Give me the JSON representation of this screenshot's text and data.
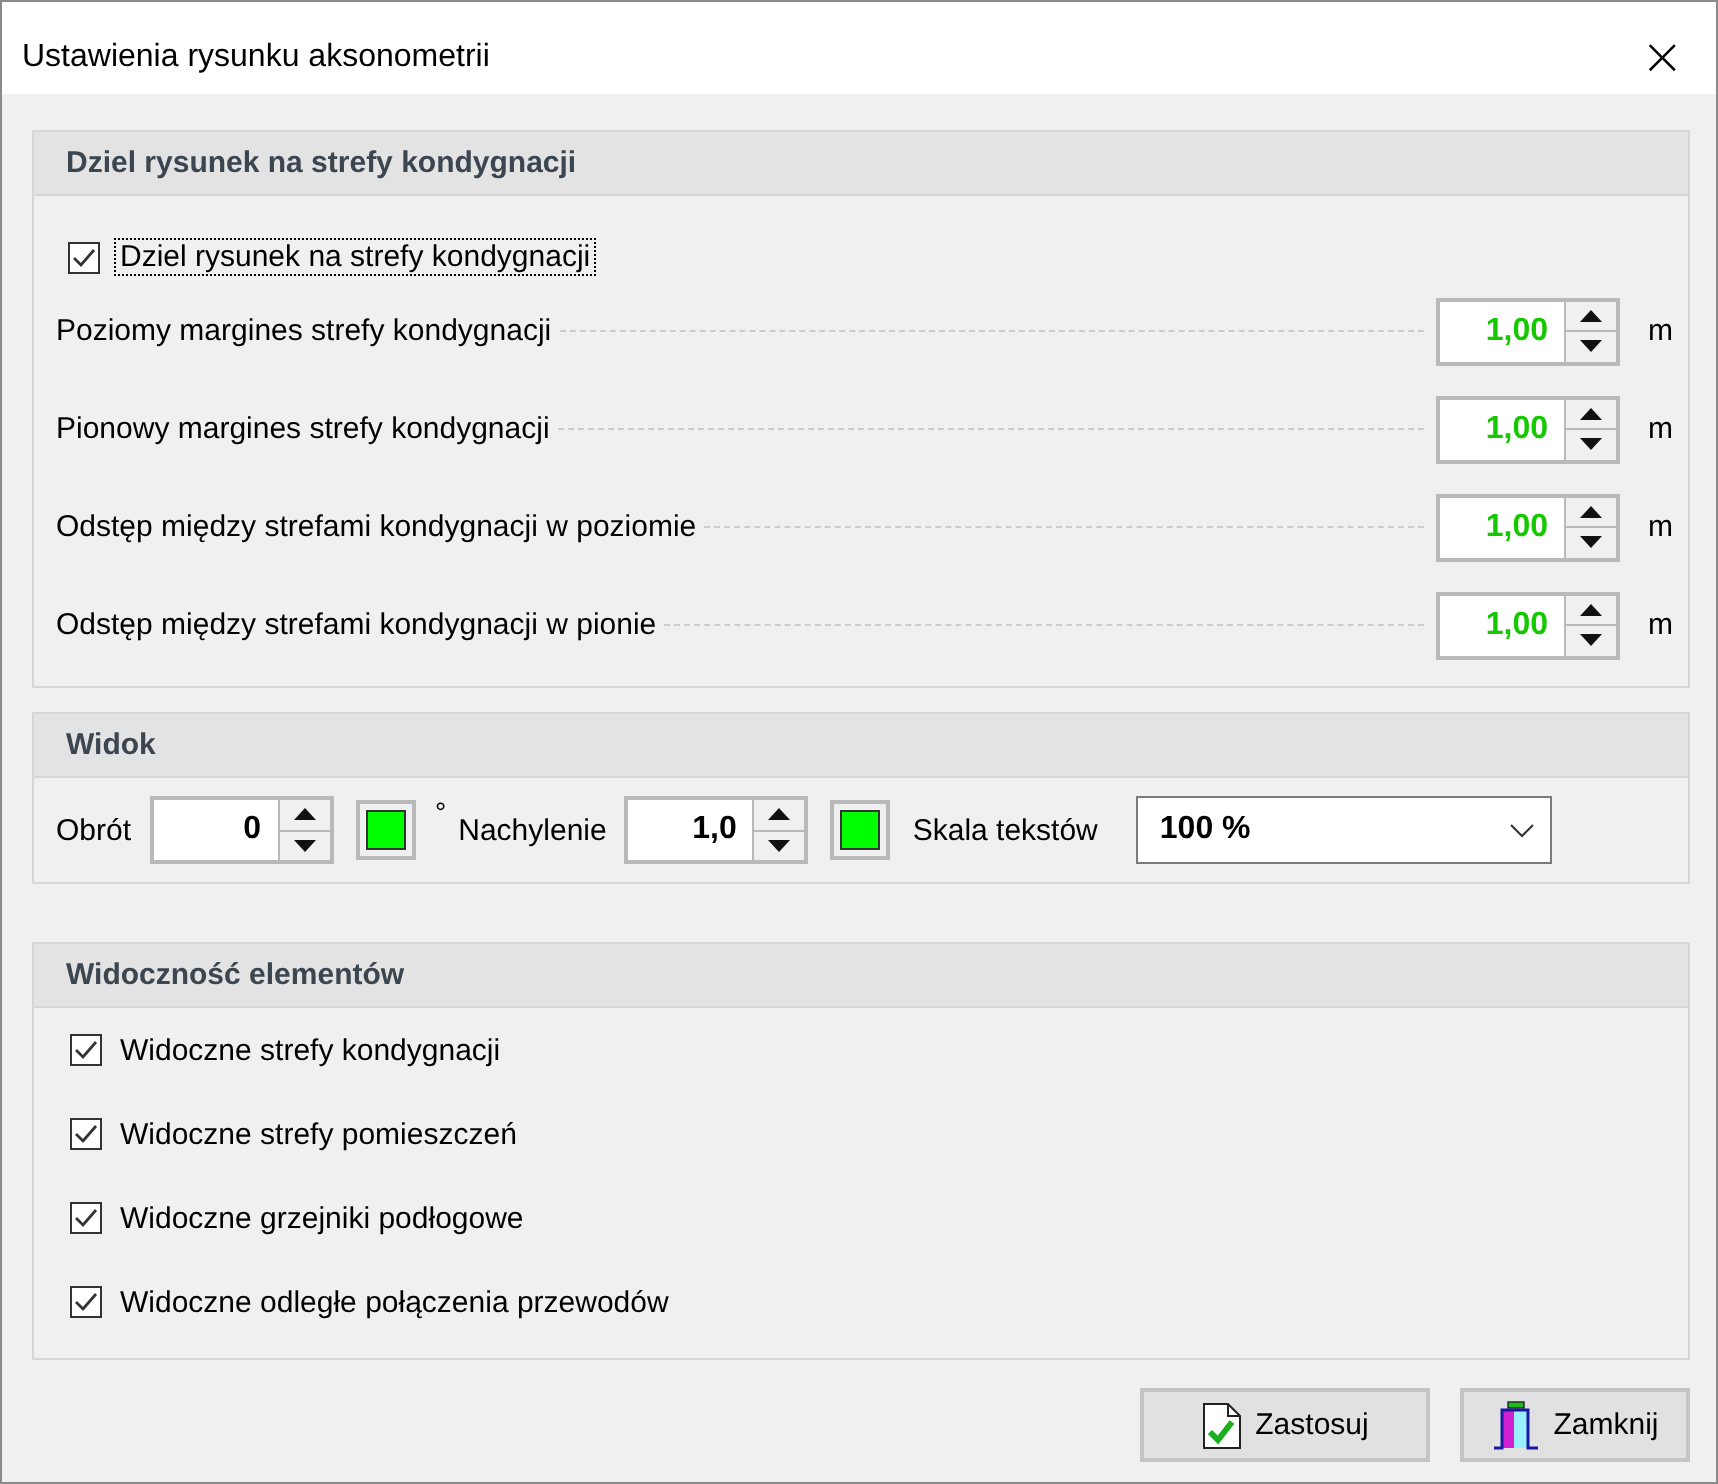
{
  "window": {
    "title": "Ustawienia rysunku aksonometrii",
    "close": "×"
  },
  "zones": {
    "title": "Dziel rysunek na strefy kondygnacji",
    "checkbox": {
      "label": "Dziel rysunek na strefy kondygnacji",
      "checked": true
    },
    "rows": [
      {
        "label": "Poziomy margines strefy kondygnacji",
        "value": "1,00",
        "unit": "m"
      },
      {
        "label": "Pionowy margines strefy kondygnacji",
        "value": "1,00",
        "unit": "m"
      },
      {
        "label": "Odstęp między strefami kondygnacji w poziomie",
        "value": "1,00",
        "unit": "m"
      },
      {
        "label": "Odstęp między strefami kondygnacji w pionie",
        "value": "1,00",
        "unit": "m"
      }
    ]
  },
  "view": {
    "title": "Widok",
    "rotation": {
      "label": "Obrót",
      "value": "0",
      "color": "#00ff00",
      "unit": "°"
    },
    "tilt": {
      "label": "Nachylenie",
      "value": "1,0",
      "color": "#00ff00"
    },
    "text_scale": {
      "label": "Skala tekstów",
      "value": "100 %"
    }
  },
  "visibility": {
    "title": "Widoczność elementów",
    "items": [
      {
        "label": "Widoczne strefy kondygnacji",
        "checked": true
      },
      {
        "label": "Widoczne strefy pomieszczeń",
        "checked": true
      },
      {
        "label": "Widoczne grzejniki podłogowe",
        "checked": true
      },
      {
        "label": "Widoczne odległe połączenia przewodów",
        "checked": true
      }
    ]
  },
  "buttons": [
    {
      "kind": "apply",
      "label": "Zastosuj"
    },
    {
      "kind": "close",
      "label": "Zamknij"
    }
  ]
}
